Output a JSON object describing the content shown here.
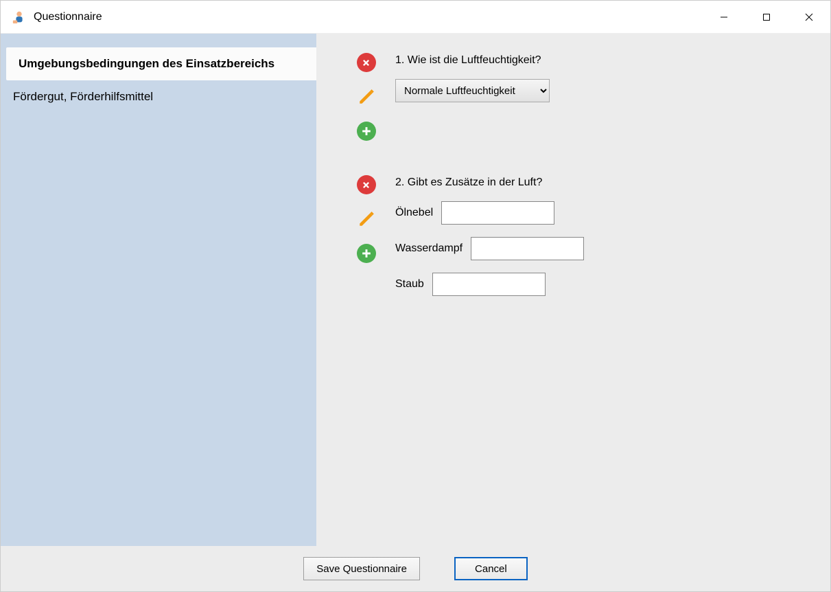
{
  "window": {
    "title": "Questionnaire"
  },
  "sidebar": {
    "items": [
      {
        "label": "Umgebungsbedingungen des Einsatzbereichs",
        "active": true
      },
      {
        "label": "Fördergut, Förderhilfsmittel",
        "active": false
      }
    ]
  },
  "questions": [
    {
      "number": "1.",
      "text": "Wie ist die Luftfeuchtigkeit?",
      "type": "select",
      "selected": "Normale Luftfeuchtigkeit"
    },
    {
      "number": "2.",
      "text": "Gibt es Zusätze in der Luft?",
      "type": "text-multi",
      "fields": [
        {
          "label": "Ölnebel",
          "value": ""
        },
        {
          "label": "Wasserdampf",
          "value": ""
        },
        {
          "label": "Staub",
          "value": ""
        }
      ]
    }
  ],
  "buttons": {
    "save": "Save Questionnaire",
    "cancel": "Cancel"
  }
}
